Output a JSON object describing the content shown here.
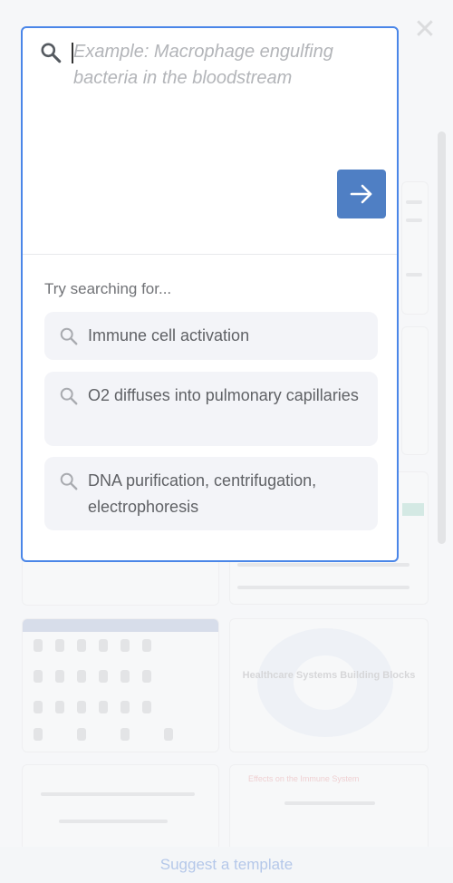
{
  "search": {
    "placeholder": "Example: Macrophage engulfing bacteria in the bloodstream",
    "value": ""
  },
  "suggestions": {
    "heading": "Try searching for...",
    "items": [
      {
        "label": "Immune cell activation"
      },
      {
        "label": "O2 diffuses into pulmonary capillaries"
      },
      {
        "label": "DNA purification, centrifugation, electrophoresis"
      }
    ]
  },
  "background": {
    "gallery_cards": [
      {
        "title": "Healthcare Systems Building Blocks"
      },
      {
        "title": "Effects on the Immune System"
      }
    ],
    "footer": {
      "suggest_label": "Suggest a template"
    }
  },
  "colors": {
    "accent": "#4a86e8",
    "submit_button": "#4f7fc4",
    "suggestion_bg": "#f3f4f8",
    "placeholder_text": "#b3b5b9"
  },
  "icons": {
    "search": "search-icon",
    "submit": "arrow-right-icon",
    "close": "close-icon"
  }
}
